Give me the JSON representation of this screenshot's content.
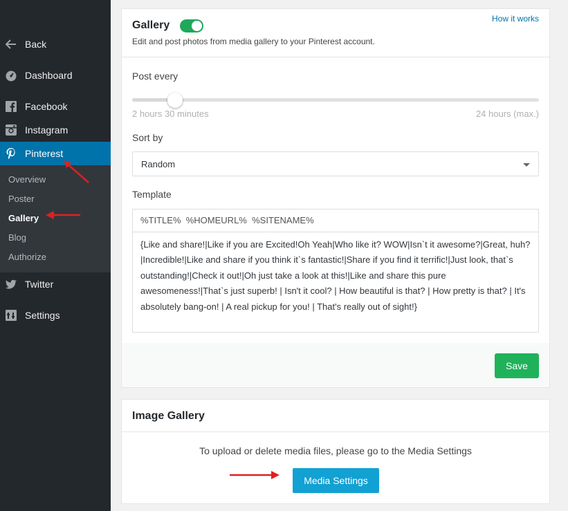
{
  "sidebar": {
    "items": [
      {
        "label": "Back",
        "icon": "arrow-left-icon"
      },
      {
        "label": "Dashboard",
        "icon": "dashboard-icon"
      },
      {
        "label": "Facebook",
        "icon": "facebook-icon"
      },
      {
        "label": "Instagram",
        "icon": "instagram-icon"
      },
      {
        "label": "Pinterest",
        "icon": "pinterest-icon"
      },
      {
        "label": "Twitter",
        "icon": "twitter-icon"
      },
      {
        "label": "Settings",
        "icon": "settings-icon"
      }
    ],
    "submenu": [
      "Overview",
      "Poster",
      "Gallery",
      "Blog",
      "Authorize"
    ],
    "active_item": "Pinterest",
    "current_submenu": "Gallery"
  },
  "gallery": {
    "title": "Gallery",
    "enabled": true,
    "description": "Edit and post photos from media gallery to your Pinterest account.",
    "how_link": "How it works",
    "post_every_label": "Post every",
    "slider_min": "2 hours 30 minutes",
    "slider_max": "24 hours (max.)",
    "slider_fraction": 0.105,
    "sort_label": "Sort by",
    "sort_value": "Random",
    "template_label": "Template",
    "template_tags": "%TITLE%  %HOMEURL%  %SITENAME%",
    "template_text": "{Like and share!|Like if you are Excited!Oh Yeah|Who like it? WOW|Isn`t it awesome?|Great, huh?|Incredible!|Like and share if you think it`s fantastic!|Share if you find it terrific!|Just look, that`s outstanding!|Check it out!|Oh just take a look at this!|Like and share this pure awesomeness!|That`s just superb! | Isn't it cool? | How beautiful is that? | How pretty is that? | It's absolutely bang-on! | A real pickup for you! | That's really out of sight!}",
    "save_label": "Save"
  },
  "image_gallery": {
    "title": "Image Gallery",
    "info": "To upload or delete media files, please go to the Media Settings",
    "button_label": "Media Settings"
  },
  "colors": {
    "sidebar_bg": "#23282d",
    "active_bg": "#0073aa",
    "toggle_on": "#1fa85a",
    "save_btn": "#1fb25a",
    "media_btn": "#12a1d3",
    "annotation_arrow": "#e02020"
  }
}
